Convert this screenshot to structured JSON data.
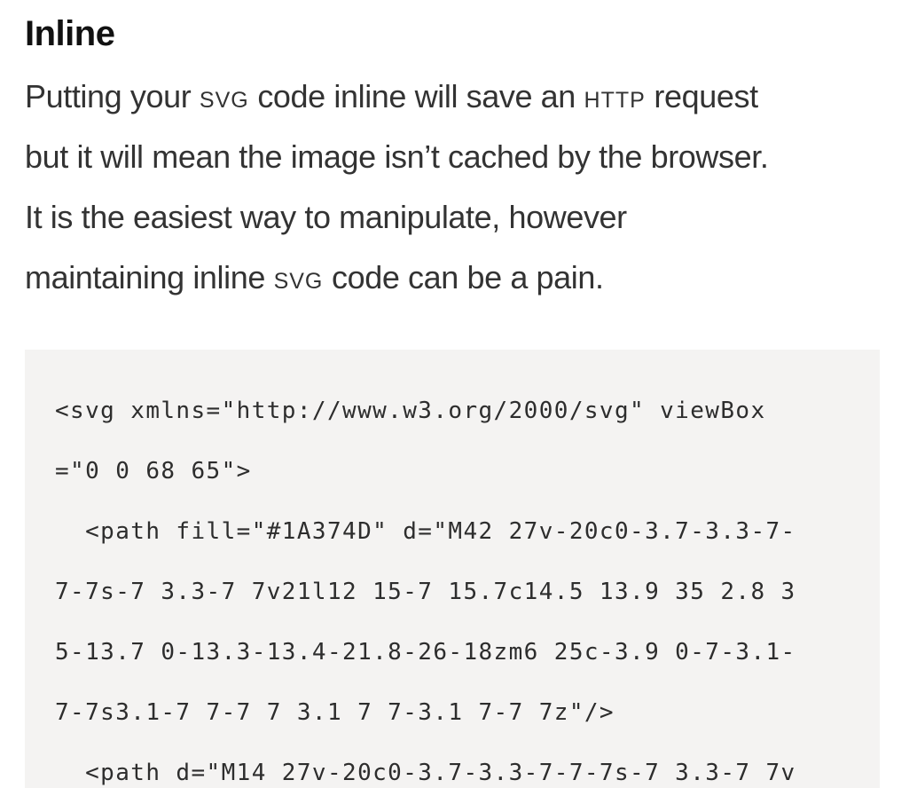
{
  "heading": "Inline",
  "paragraph": {
    "line1_a": "Putting your ",
    "line1_abbr": "SVG",
    "line1_b": " code inline will save an ",
    "line1_abbr2": "HTTP",
    "line1_c": " request",
    "line2": "but it will mean the image isn’t cached by the browser.",
    "line3": "It is the easiest way to manipulate, however",
    "line4_a": "maintaining inline ",
    "line4_abbr": "SVG",
    "line4_b": " code can be a pain."
  },
  "code": {
    "lines": [
      "<svg xmlns=\"http://www.w3.org/2000/svg\" viewBox",
      "=\"0 0 68 65\">",
      "  <path fill=\"#1A374D\" d=\"M42 27v-20c0-3.7-3.3-7-",
      "7-7s-7 3.3-7 7v21l12 15-7 15.7c14.5 13.9 35 2.8 3",
      "5-13.7 0-13.3-13.4-21.8-26-18zm6 25c-3.9 0-7-3.1-",
      "7-7s3.1-7 7-7 7 3.1 7 7-3.1 7-7 7z\"/>",
      "  <path d=\"M14 27v-20c0-3.7-3.3-7-7-7s-7 3.3-7 7v"
    ]
  }
}
